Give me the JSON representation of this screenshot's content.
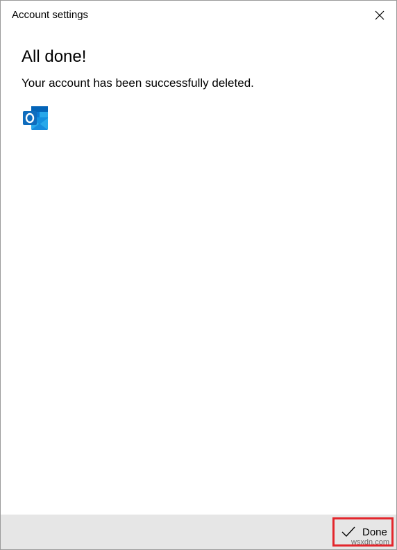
{
  "window": {
    "title": "Account settings"
  },
  "main": {
    "heading": "All done!",
    "message": "Your account has been successfully deleted.",
    "app_icon": "outlook-icon"
  },
  "footer": {
    "done_label": "Done",
    "done_icon": "checkmark-icon",
    "watermark": "wsxdn.com"
  },
  "colors": {
    "highlight_border": "#e3262c",
    "footer_background": "#e6e6e6",
    "outlook_blue": "#0f6cbd"
  }
}
